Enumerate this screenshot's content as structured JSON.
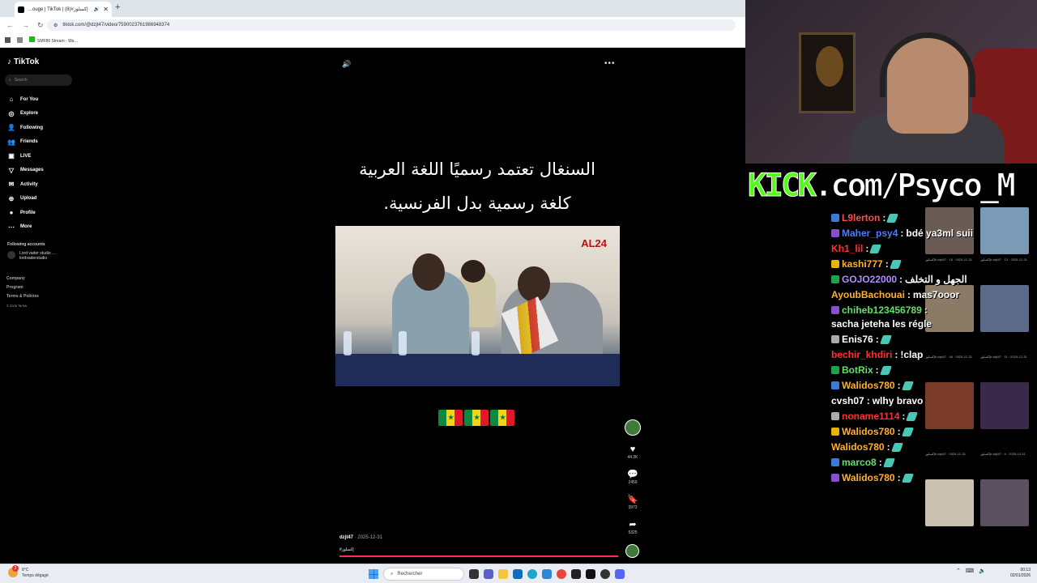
{
  "browser": {
    "tab_title": "…ouge | TikTok | إكسلوز#(8)",
    "url": "tiktok.com/@dzjt47/video/7590023761986948374",
    "bookmark": "SMF86 Stream - Wa…"
  },
  "tiktok": {
    "logo": "TikTok",
    "search_placeholder": "Search",
    "nav": [
      {
        "icon": "⌂",
        "label": "For You"
      },
      {
        "icon": "◎",
        "label": "Explore"
      },
      {
        "icon": "👤",
        "label": "Following"
      },
      {
        "icon": "👥",
        "label": "Friends"
      },
      {
        "icon": "▣",
        "label": "LIVE"
      },
      {
        "icon": "▽",
        "label": "Messages"
      },
      {
        "icon": "✉",
        "label": "Activity"
      },
      {
        "icon": "⊕",
        "label": "Upload"
      },
      {
        "icon": "●",
        "label": "Profile"
      },
      {
        "icon": "⋯",
        "label": "More"
      }
    ],
    "following_title": "Following accounts",
    "following_name": "Lord vader studio …",
    "following_handle": "lordvaderstudio",
    "footer": [
      "Company",
      "Program",
      "Terms & Policies"
    ],
    "copyright": "© 2026 TikTok",
    "video_text_line1": "السنغال تعتمد رسميًا اللغة العربية",
    "video_text_line2": "كلغة رسمية بدل الفرنسية.",
    "watermark": "AL24",
    "likes": "44.2K",
    "comments": "2459",
    "saves": "3973",
    "shares": "5325",
    "author": "dzjt47",
    "date": "2025-12-31",
    "hashtag": "#إكسلوز",
    "progress": 1.0,
    "flag_colors": [
      "#0a8a3a",
      "#f5d417",
      "#e0192a"
    ]
  },
  "stream": {
    "kick_prefix": "KICK",
    "kick_rest": ".com/Psyco_M",
    "chat": [
      {
        "user": "L9lerton",
        "color": "#ff4d4d",
        "msg": ""
      },
      {
        "user": "Maher_psy4",
        "color": "#4d7bff",
        "msg": "bdé ya3ml suii"
      },
      {
        "user": "Kh1_lil",
        "color": "#ff3030",
        "msg": ""
      },
      {
        "user": "kashi777",
        "color": "#ffb030",
        "msg": ""
      },
      {
        "user": "GOJO22000",
        "color": "#b08cff",
        "msg": "الجهل و التخلف"
      },
      {
        "user": "AyoubBachouai",
        "color": "#ffb030",
        "msg": "mas7ooor"
      },
      {
        "user": "chiheb123456789",
        "color": "#62e06a",
        "msg": "sacha jeteha les régle"
      },
      {
        "user": "Enis76",
        "color": "#ffffff",
        "msg": ""
      },
      {
        "user": "bechir_khdiri",
        "color": "#ff3030",
        "msg": "!clap"
      },
      {
        "user": "BotRix",
        "color": "#62e06a",
        "msg": ""
      },
      {
        "user": "Walidos780",
        "color": "#ffb030",
        "msg": ""
      },
      {
        "user": "cvsh07",
        "color": "#ffffff",
        "msg": "wlhy bravo"
      },
      {
        "user": "noname1114",
        "color": "#ff3030",
        "msg": ""
      },
      {
        "user": "Walidos780",
        "color": "#ffb030",
        "msg": ""
      },
      {
        "user": "Walidos780",
        "color": "#ffb030",
        "msg": ""
      },
      {
        "user": "marco8",
        "color": "#62e06a",
        "msg": ""
      },
      {
        "user": "Walidos780",
        "color": "#ffb030",
        "msg": ""
      }
    ],
    "thumb_captions": [
      "إكسلوز# dzjt47 · 15 · 2025-12-31",
      "إكسلوز# dzjt47 · 13 · 2025-12-31",
      "إكسلوز# dzjt47 · 46 · 2025-12-31",
      "إكسلوز# dzjt47 · 11 · 2025-12-31",
      "إكسلوز# dzjt47 · 2025-12-31",
      "إكسلوز# dzjt47 · 4 · 2025-12-31"
    ]
  },
  "taskbar": {
    "temp": "8°C",
    "weather": "Temps dégagé",
    "search": "Rechercher",
    "time": "00:13",
    "date": "02/01/2026",
    "badge": "2"
  }
}
